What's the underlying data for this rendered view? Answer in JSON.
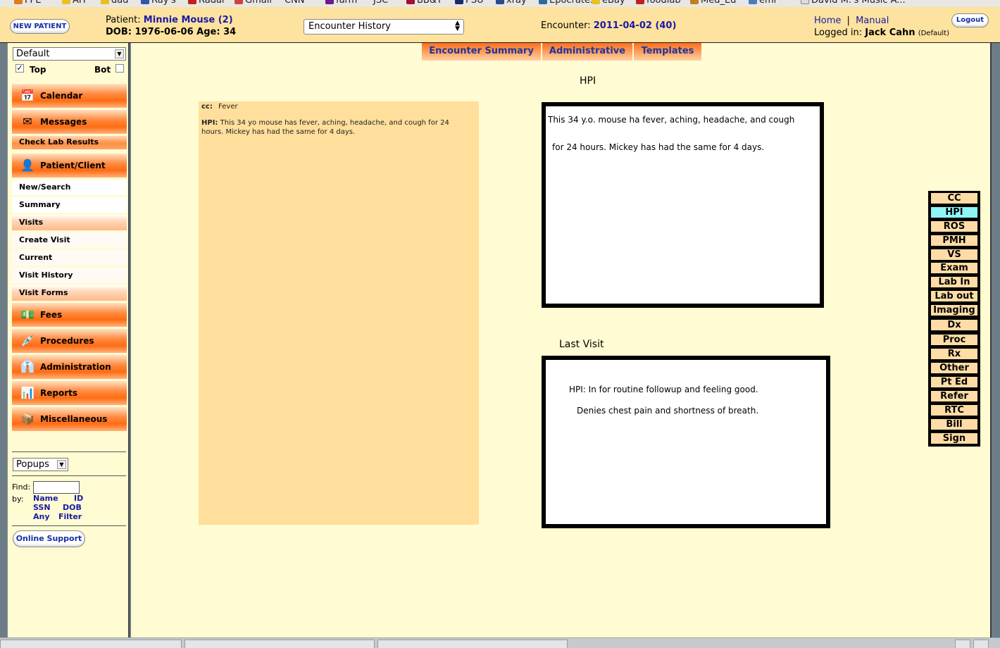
{
  "bookmarks": [
    "FPE",
    "AH",
    "dad",
    "Ray's",
    "Radar",
    "Gmail",
    "CNN",
    "farm",
    "JSC",
    "BB&T",
    "PSU",
    "xray",
    "Epocrates",
    "eBay",
    "foodlab",
    "Med_Ed",
    "emr",
    "David M.'s Music A..."
  ],
  "header": {
    "new_patient_label": "NEW PATIENT",
    "patient_prefix": "Patient:",
    "patient_name": "Minnie Mouse (2)",
    "dob_line": "DOB: 1976-06-06 Age: 34",
    "encounter_select_value": "Encounter History",
    "encounter_prefix": "Encounter:",
    "encounter_value": "2011-04-02 (40)",
    "home_label": "Home",
    "separator": "|",
    "manual_label": "Manual",
    "logged_prefix": "Logged in:",
    "logged_user": "Jack Cahn",
    "logged_role": "(Default)",
    "logout_label": "Logout"
  },
  "sidebar": {
    "view_select": "Default",
    "top_label": "Top",
    "top_checked": "✓",
    "bot_label": "Bot",
    "major": [
      {
        "label": "Calendar",
        "icon": "calendar-icon",
        "glyph": "📅"
      },
      {
        "label": "Messages",
        "icon": "envelope-icon",
        "glyph": "✉"
      },
      {
        "label": "Patient/Client",
        "icon": "person-icon",
        "glyph": "👤"
      },
      {
        "label": "Fees",
        "icon": "money-icon",
        "glyph": "💵"
      },
      {
        "label": "Procedures",
        "icon": "syringe-icon",
        "glyph": "💉"
      },
      {
        "label": "Administration",
        "icon": "admin-icon",
        "glyph": "👔"
      },
      {
        "label": "Reports",
        "icon": "bar-chart-icon",
        "glyph": "📊"
      },
      {
        "label": "Miscellaneous",
        "icon": "box-icon",
        "glyph": "📦"
      }
    ],
    "check_lab_label": "Check Lab Results",
    "patient_sub": [
      "New/Search",
      "Summary"
    ],
    "visits_label": "Visits",
    "visits_sub": [
      "Create Visit",
      "Current",
      "Visit History"
    ],
    "visit_forms_label": "Visit Forms",
    "popups_select": "Popups",
    "find_label": "Find:",
    "by_label": "by:",
    "find_links": [
      "Name",
      "ID",
      "SSN",
      "DOB",
      "Any",
      "Filter"
    ],
    "online_support_label": "Online Support"
  },
  "tabs": [
    "Encounter Summary",
    "Administrative",
    "Templates"
  ],
  "summary": {
    "cc_label": "cc:",
    "cc_value": "Fever",
    "hpi_label": "HPI:",
    "hpi_text": "This 34 yo mouse has fever, aching, headache, and cough for 24 hours. Mickey has had the same for 4 days."
  },
  "hpi_panel": {
    "title": "HPI",
    "line1": "This 34 y.o. mouse ha fever, aching, headache, and cough",
    "line2": "for 24 hours.  Mickey has had the same for 4 days."
  },
  "last_visit_panel": {
    "title": "Last Visit",
    "line1": "HPI: In for routine followup and feeling good.",
    "line2": "Denies chest pain and shortness of breath."
  },
  "right_nav": {
    "items": [
      "CC",
      "HPI",
      "ROS",
      "PMH",
      "VS",
      "Exam",
      "Lab  In",
      "Lab  out",
      "Imaging",
      "Dx",
      "Proc",
      "Rx",
      "Other",
      "Pt Ed",
      "Refer",
      "RTC",
      "Bill",
      "Sign"
    ],
    "active": "HPI"
  },
  "colors": {
    "header_bg": "#fde39f",
    "page_bg": "#fffbd2",
    "accent_orange": "#ff6b12",
    "link_blue": "#1a1aa6",
    "nav_active": "#8ff6f6"
  }
}
